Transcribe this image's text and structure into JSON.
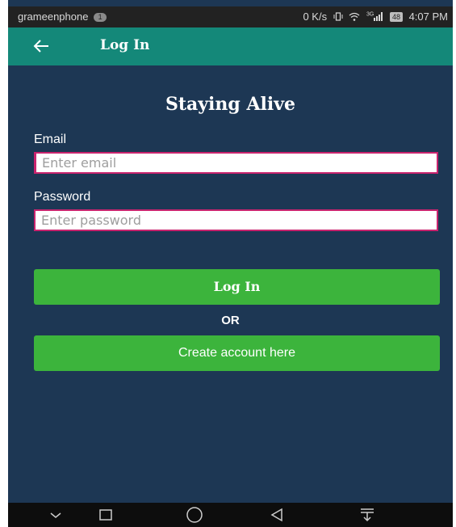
{
  "status_bar": {
    "carrier": "grameenphone",
    "notification_count": "1",
    "network_speed": "0 K/s",
    "signal_label": "3G",
    "battery": "48",
    "time": "4:07 PM"
  },
  "app_bar": {
    "back_icon": "arrow-left-icon",
    "title": "Log In"
  },
  "form": {
    "app_title": "Staying Alive",
    "email_label": "Email",
    "email_placeholder": "Enter email",
    "password_label": "Password",
    "password_placeholder": "Enter password",
    "login_button": "Log In",
    "or_text": "OR",
    "create_account_button": "Create account here"
  },
  "nav_bar": {
    "icons": [
      "chevron-down-icon",
      "recents-square-icon",
      "home-circle-icon",
      "back-triangle-icon",
      "notification-pull-icon"
    ]
  },
  "colors": {
    "background": "#1d3754",
    "app_bar": "#148879",
    "button": "#3cb43c",
    "field_border": "#c9246e",
    "status_bar": "#222222",
    "nav_bar": "#0d0d0d"
  }
}
